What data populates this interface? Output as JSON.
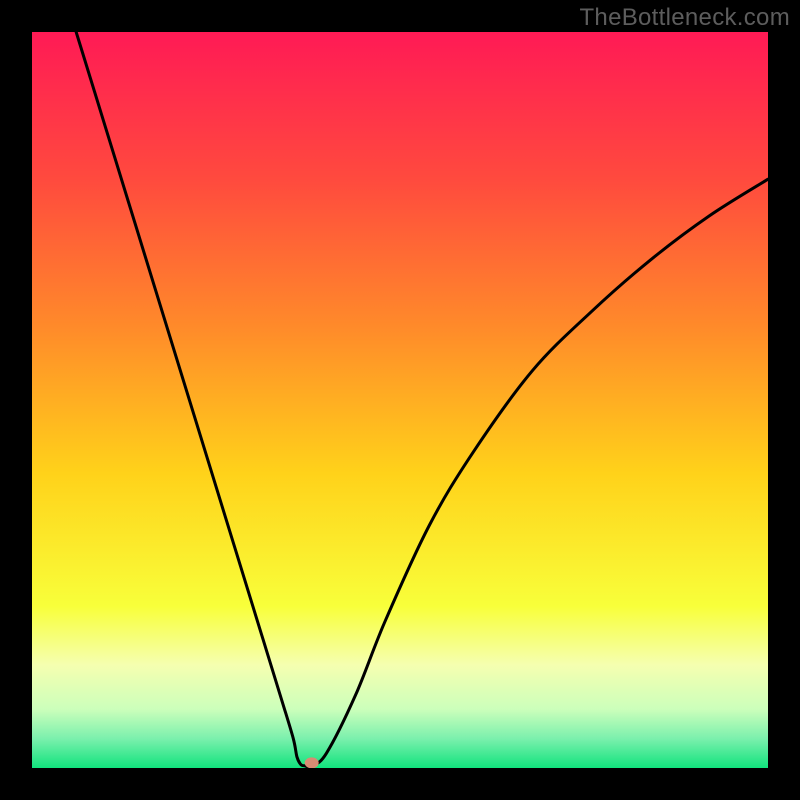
{
  "watermark": "TheBottleneck.com",
  "colors": {
    "gradient_stops": [
      {
        "offset": 0.0,
        "color": "#ff1a55"
      },
      {
        "offset": 0.2,
        "color": "#ff4a3e"
      },
      {
        "offset": 0.4,
        "color": "#ff8a2a"
      },
      {
        "offset": 0.6,
        "color": "#ffd21a"
      },
      {
        "offset": 0.78,
        "color": "#f8ff3a"
      },
      {
        "offset": 0.86,
        "color": "#f5ffb0"
      },
      {
        "offset": 0.92,
        "color": "#ccffbb"
      },
      {
        "offset": 0.96,
        "color": "#7bf0ad"
      },
      {
        "offset": 1.0,
        "color": "#11e37d"
      }
    ],
    "curve": "#000000",
    "marker": "#d88b73",
    "frame": "#000000"
  },
  "chart_data": {
    "type": "line",
    "title": "",
    "xlabel": "",
    "ylabel": "",
    "xlim": [
      0,
      100
    ],
    "ylim": [
      0,
      100
    ],
    "series": [
      {
        "name": "curve",
        "x": [
          6,
          10,
          14,
          18,
          22,
          26,
          30,
          32,
          34,
          35.5,
          36,
          36.5,
          37,
          38,
          40,
          44,
          48,
          54,
          60,
          68,
          76,
          84,
          92,
          100
        ],
        "y": [
          100,
          87,
          74,
          61,
          48,
          35,
          22,
          15.5,
          9,
          4,
          1.5,
          0.5,
          0.3,
          0.3,
          2,
          10,
          20,
          33,
          43,
          54,
          62,
          69,
          75,
          80
        ]
      }
    ],
    "marker": {
      "x": 38,
      "y": 0.7
    },
    "notes": "Background is a vertical gradient from red (top) through orange/yellow to green (bottom). Values are estimated from the plot; no axis ticks or labels are shown."
  }
}
